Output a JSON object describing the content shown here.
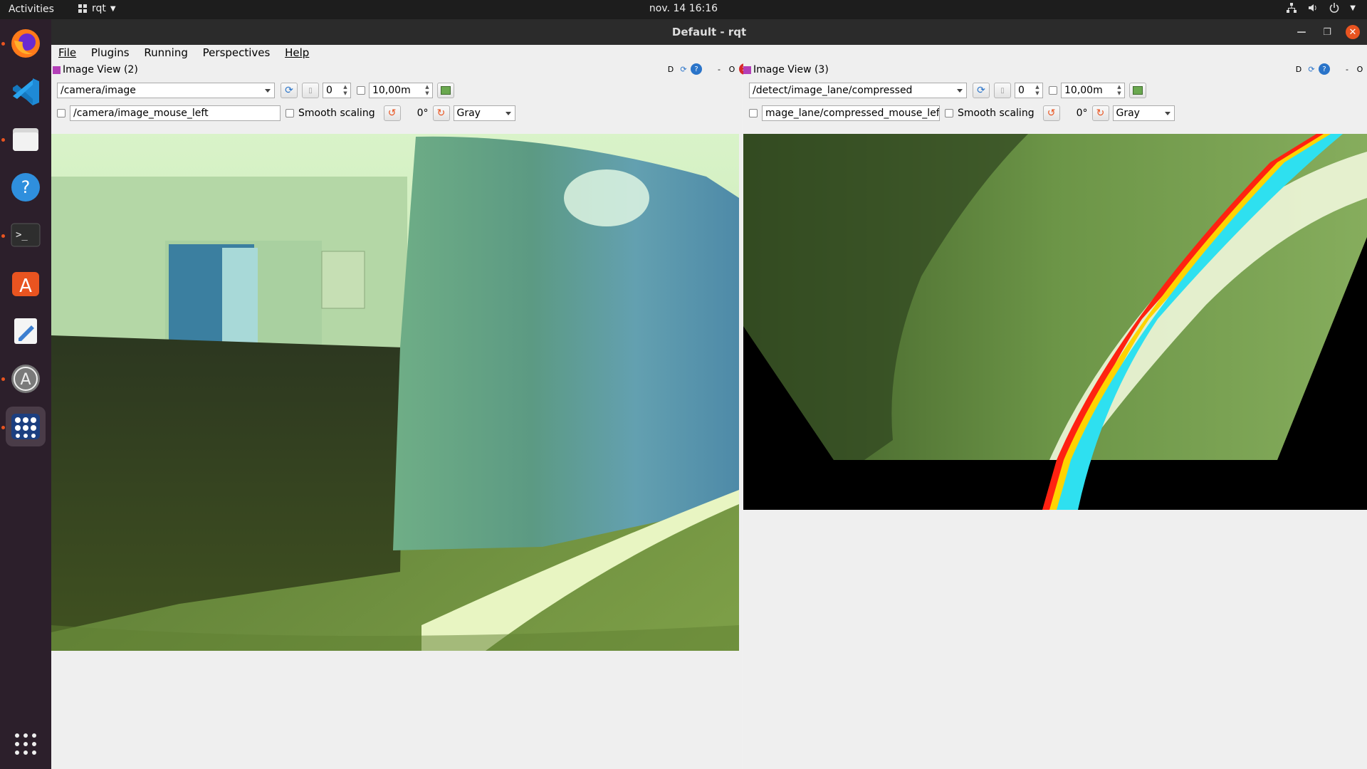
{
  "topbar": {
    "activities": "Activities",
    "app_name": "rqt",
    "clock": "nov. 14  16:16"
  },
  "window": {
    "title": "Default - rqt"
  },
  "menu": {
    "file": "File",
    "plugins": "Plugins",
    "running": "Running",
    "perspectives": "Perspectives",
    "help": "Help"
  },
  "dock": {
    "items": [
      "firefox-icon",
      "vscode-icon",
      "files-icon",
      "help-icon",
      "terminal-icon",
      "software-icon",
      "text-editor-icon",
      "updater-icon",
      "app-grid-icon"
    ],
    "show_apps": "show-applications-icon"
  },
  "left": {
    "title": "Image View (2)",
    "tools_d": "D",
    "tools_minus": "-",
    "tools_o": "O",
    "topic": "/camera/image",
    "spin_value": "0",
    "duration": "10,00m",
    "mouse_topic": "/camera/image_mouse_left",
    "smooth": "Smooth scaling",
    "rotation": "0°",
    "color_mode": "Gray"
  },
  "right": {
    "title": "Image View (3)",
    "tools_d": "D",
    "tools_minus": "-",
    "tools_o": "O",
    "topic": "/detect/image_lane/compressed",
    "spin_value": "0",
    "duration": "10,00m",
    "mouse_topic": "mage_lane/compressed_mouse_left",
    "smooth": "Smooth scaling",
    "rotation": "0°",
    "color_mode": "Gray"
  }
}
